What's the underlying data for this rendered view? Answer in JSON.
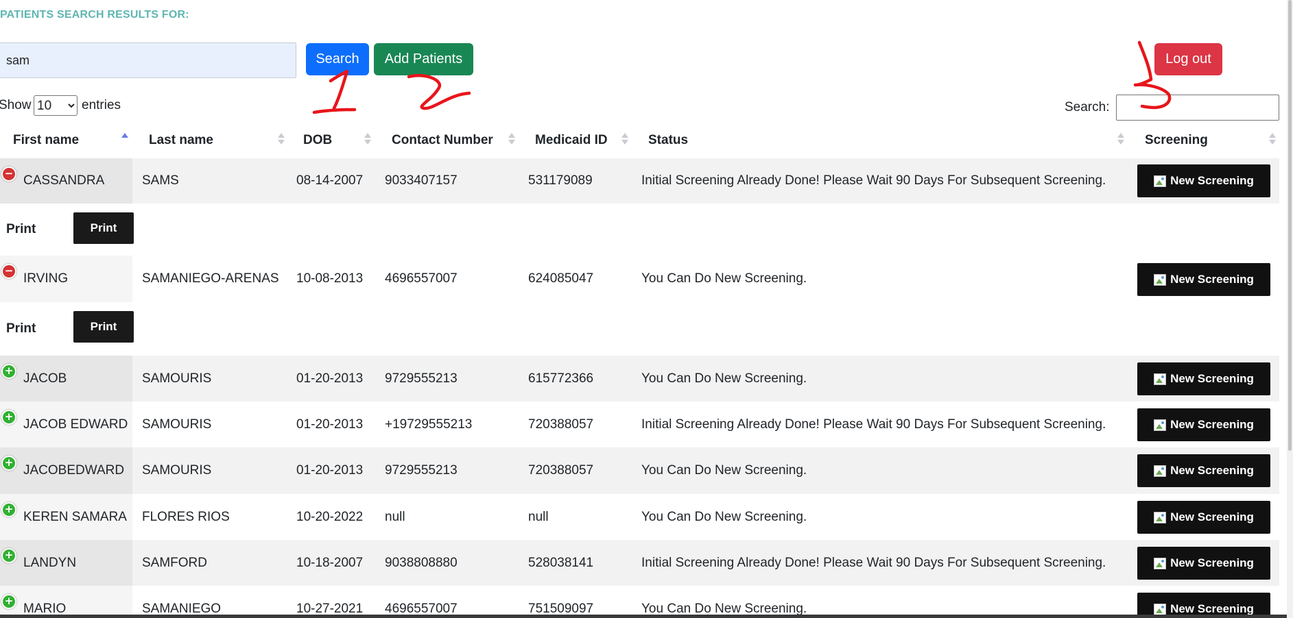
{
  "header": {
    "title": "PATIENTS SEARCH RESULTS FOR:",
    "query_value": "sam",
    "search_button": "Search",
    "add_button": "Add Patients",
    "logout_button": "Log out"
  },
  "length_control": {
    "show_label": "Show",
    "selected": "10",
    "entries_label": "entries"
  },
  "filter": {
    "label": "Search:",
    "value": ""
  },
  "columns": [
    "First name",
    "Last name",
    "DOB",
    "Contact Number",
    "Medicaid ID",
    "Status",
    "Screening"
  ],
  "rows": [
    {
      "first": "CASSANDRA",
      "last": "SAMS",
      "dob": "08-14-2007",
      "contact": "9033407157",
      "medicaid": "531179089",
      "status": "Initial Screening Already Done! Please Wait 90 Days For Subsequent Screening.",
      "expanded": true
    },
    {
      "first": "IRVING",
      "last": "SAMANIEGO-ARENAS",
      "dob": "10-08-2013",
      "contact": "4696557007",
      "medicaid": "624085047",
      "status": "You Can Do New Screening.",
      "expanded": true
    },
    {
      "first": "JACOB",
      "last": "SAMOURIS",
      "dob": "01-20-2013",
      "contact": "9729555213",
      "medicaid": "615772366",
      "status": "You Can Do New Screening.",
      "expanded": false
    },
    {
      "first": "JACOB EDWARD",
      "last": "SAMOURIS",
      "dob": "01-20-2013",
      "contact": "+19729555213",
      "medicaid": "720388057",
      "status": "Initial Screening Already Done! Please Wait 90 Days For Subsequent Screening.",
      "expanded": false
    },
    {
      "first": "JACOBEDWARD",
      "last": "SAMOURIS",
      "dob": "01-20-2013",
      "contact": "9729555213",
      "medicaid": "720388057",
      "status": "You Can Do New Screening.",
      "expanded": false
    },
    {
      "first": "KEREN SAMARA",
      "last": "FLORES RIOS",
      "dob": "10-20-2022",
      "contact": "null",
      "medicaid": "null",
      "status": "You Can Do New Screening.",
      "expanded": false
    },
    {
      "first": "LANDYN",
      "last": "SAMFORD",
      "dob": "10-18-2007",
      "contact": "9038808880",
      "medicaid": "528038141",
      "status": "Initial Screening Already Done! Please Wait 90 Days For Subsequent Screening.",
      "expanded": false
    },
    {
      "first": "MARIO",
      "last": "SAMANIEGO",
      "dob": "10-27-2021",
      "contact": "4696557007",
      "medicaid": "751509097",
      "status": "You Can Do New Screening.",
      "expanded": false
    }
  ],
  "row_button_label": "New Screening",
  "child_row": {
    "label": "Print",
    "button": "Print"
  },
  "icons": {
    "row_open": "minus-circle-icon",
    "row_closed": "plus-circle-icon",
    "button_image": "broken-image-icon"
  },
  "colors": {
    "search": "#0d6efd",
    "add": "#198754",
    "logout": "#dc3545",
    "heading": "#5fb6b0",
    "annotation": "#e8151b"
  },
  "annotations": [
    "1",
    "2",
    "3"
  ]
}
